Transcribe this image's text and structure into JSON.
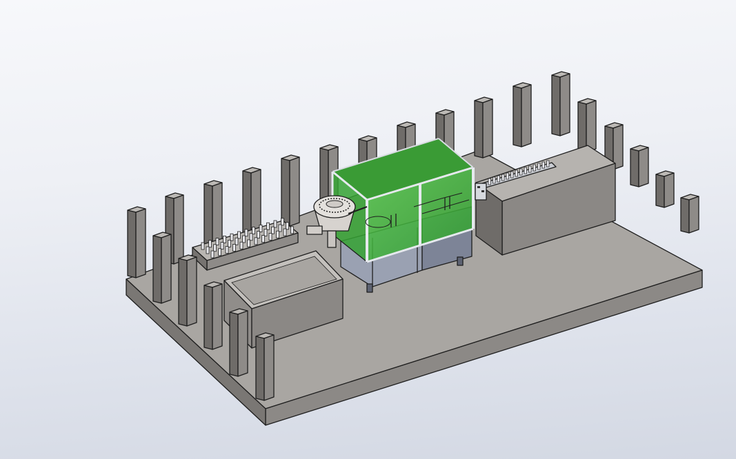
{
  "viewport": {
    "background_top": "#f7f8fb",
    "background_bottom": "#d3d8e3"
  },
  "scene": {
    "model": "production-line-layout",
    "colors": {
      "floor_top": "#a9a6a2",
      "floor_front": "#8c8986",
      "floor_side": "#7a7774",
      "pillar_front": "#8e8b88",
      "pillar_side": "#6f6c69",
      "pillar_top": "#bcb9b5",
      "enclosure_glass": "#3fb43a",
      "machine_base": "#8c93a5",
      "frame": "#d8dce2"
    },
    "components": [
      "floor-slab",
      "boundary-pillars",
      "bottle-tray",
      "collection-bin",
      "vibratory-bowl-feeder",
      "glass-enclosure",
      "machine-base-cabinet",
      "control-panel",
      "outfeed-conveyor",
      "storage-block"
    ]
  }
}
